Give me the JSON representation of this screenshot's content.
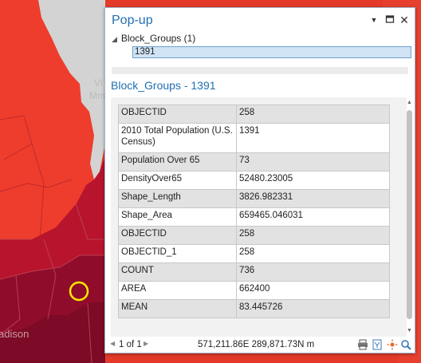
{
  "map": {
    "label_city_fragment": "Vi",
    "label_city_fragment2": "Mm",
    "label_madison": "adison",
    "colors": {
      "dark": "#8e0e2a",
      "mid": "#b7132c",
      "orange": "#e8372b",
      "water": "#d4d4d4"
    }
  },
  "popup": {
    "title": "Pop-up",
    "layer_node": "Block_Groups  (1)",
    "selected_feature": "1391",
    "section_title": "Block_Groups - 1391",
    "rows": [
      {
        "key": "OBJECTID",
        "value": "258"
      },
      {
        "key": "2010 Total Population (U.S. Census)",
        "value": "1391"
      },
      {
        "key": "Population Over 65",
        "value": "73"
      },
      {
        "key": "DensityOver65",
        "value": "52480.23005"
      },
      {
        "key": "Shape_Length",
        "value": "3826.982331"
      },
      {
        "key": "Shape_Area",
        "value": "659465.046031"
      },
      {
        "key": "OBJECTID",
        "value": "258"
      },
      {
        "key": "OBJECTID_1",
        "value": "258"
      },
      {
        "key": "COUNT",
        "value": "736"
      },
      {
        "key": "AREA",
        "value": "662400"
      },
      {
        "key": "MEAN",
        "value": "83.445726"
      }
    ],
    "pager": "1 of 1",
    "coordinates": "571,211.86E 289,871.73N m",
    "icons": [
      "print-icon",
      "export-icon",
      "flash-icon",
      "zoom-to-icon"
    ]
  }
}
